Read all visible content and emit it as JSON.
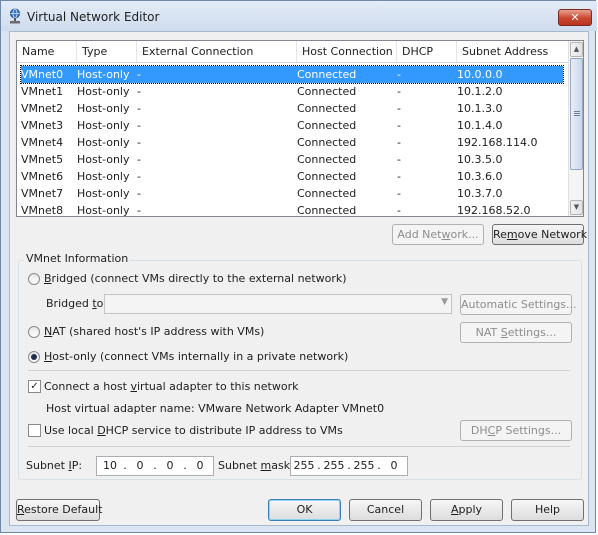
{
  "window": {
    "title": "Virtual Network Editor",
    "close_glyph": "✕",
    "icon": "network-icon"
  },
  "table": {
    "columns": [
      "Name",
      "Type",
      "External Connection",
      "Host Connection",
      "DHCP",
      "Subnet Address"
    ],
    "rows": [
      [
        "VMnet0",
        "Host-only",
        "-",
        "Connected",
        "-",
        "10.0.0.0"
      ],
      [
        "VMnet1",
        "Host-only",
        "-",
        "Connected",
        "-",
        "10.1.2.0"
      ],
      [
        "VMnet2",
        "Host-only",
        "-",
        "Connected",
        "-",
        "10.1.3.0"
      ],
      [
        "VMnet3",
        "Host-only",
        "-",
        "Connected",
        "-",
        "10.1.4.0"
      ],
      [
        "VMnet4",
        "Host-only",
        "-",
        "Connected",
        "-",
        "192.168.114.0"
      ],
      [
        "VMnet5",
        "Host-only",
        "-",
        "Connected",
        "-",
        "10.3.5.0"
      ],
      [
        "VMnet6",
        "Host-only",
        "-",
        "Connected",
        "-",
        "10.3.6.0"
      ],
      [
        "VMnet7",
        "Host-only",
        "-",
        "Connected",
        "-",
        "10.3.7.0"
      ],
      [
        "VMnet8",
        "Host-only",
        "-",
        "Connected",
        "-",
        "192.168.52.0"
      ]
    ],
    "selected_row": 0
  },
  "buttons": {
    "add_network_pre": "Add Net",
    "add_network_u": "w",
    "add_network_post": "ork...",
    "remove_network_pre": "Re",
    "remove_network_u": "m",
    "remove_network_post": "ove Network",
    "automatic_settings": "Automatic Settings...",
    "nat_settings_pre": "NAT ",
    "nat_settings_u": "S",
    "nat_settings_post": "ettings...",
    "dhcp_settings_pre": "DH",
    "dhcp_settings_u": "C",
    "dhcp_settings_post": "P Settings...",
    "restore_default_pre": "",
    "restore_default_u": "R",
    "restore_default_post": "estore Default",
    "ok": "OK",
    "cancel": "Cancel",
    "apply_pre": "",
    "apply_u": "A",
    "apply_post": "pply",
    "help": "Help"
  },
  "vmnet_info": {
    "group_label": "VMnet Information",
    "bridged_pre": "",
    "bridged_u": "B",
    "bridged_post": "ridged (connect VMs directly to the external network)",
    "bridged_to_pre": "Bridged ",
    "bridged_to_u": "t",
    "bridged_to_post": "o:",
    "bridged_to_value": "",
    "nat_pre": "",
    "nat_u": "N",
    "nat_post": "AT (shared host's IP address with VMs)",
    "hostonly_pre": "",
    "hostonly_u": "H",
    "hostonly_post": "ost-only (connect VMs internally in a private network)",
    "mode": "host-only",
    "connect_adapter_pre": "Connect a host ",
    "connect_adapter_u": "v",
    "connect_adapter_post": "irtual adapter to this network",
    "connect_adapter_checked": true,
    "adapter_name_label": "Host virtual adapter name: VMware Network Adapter VMnet0",
    "dhcp_pre": "Use local ",
    "dhcp_u": "D",
    "dhcp_post": "HCP service to distribute IP address to VMs",
    "dhcp_checked": false,
    "check_glyph": "✓"
  },
  "subnet": {
    "ip_label_pre": "Subnet ",
    "ip_label_u": "I",
    "ip_label_post": "P:",
    "ip": [
      "10",
      "0",
      "0",
      "0"
    ],
    "mask_label_pre": "Subnet ",
    "mask_label_u": "m",
    "mask_label_post": "ask:",
    "mask": [
      "255",
      "255",
      "255",
      "0"
    ],
    "dot": "."
  }
}
